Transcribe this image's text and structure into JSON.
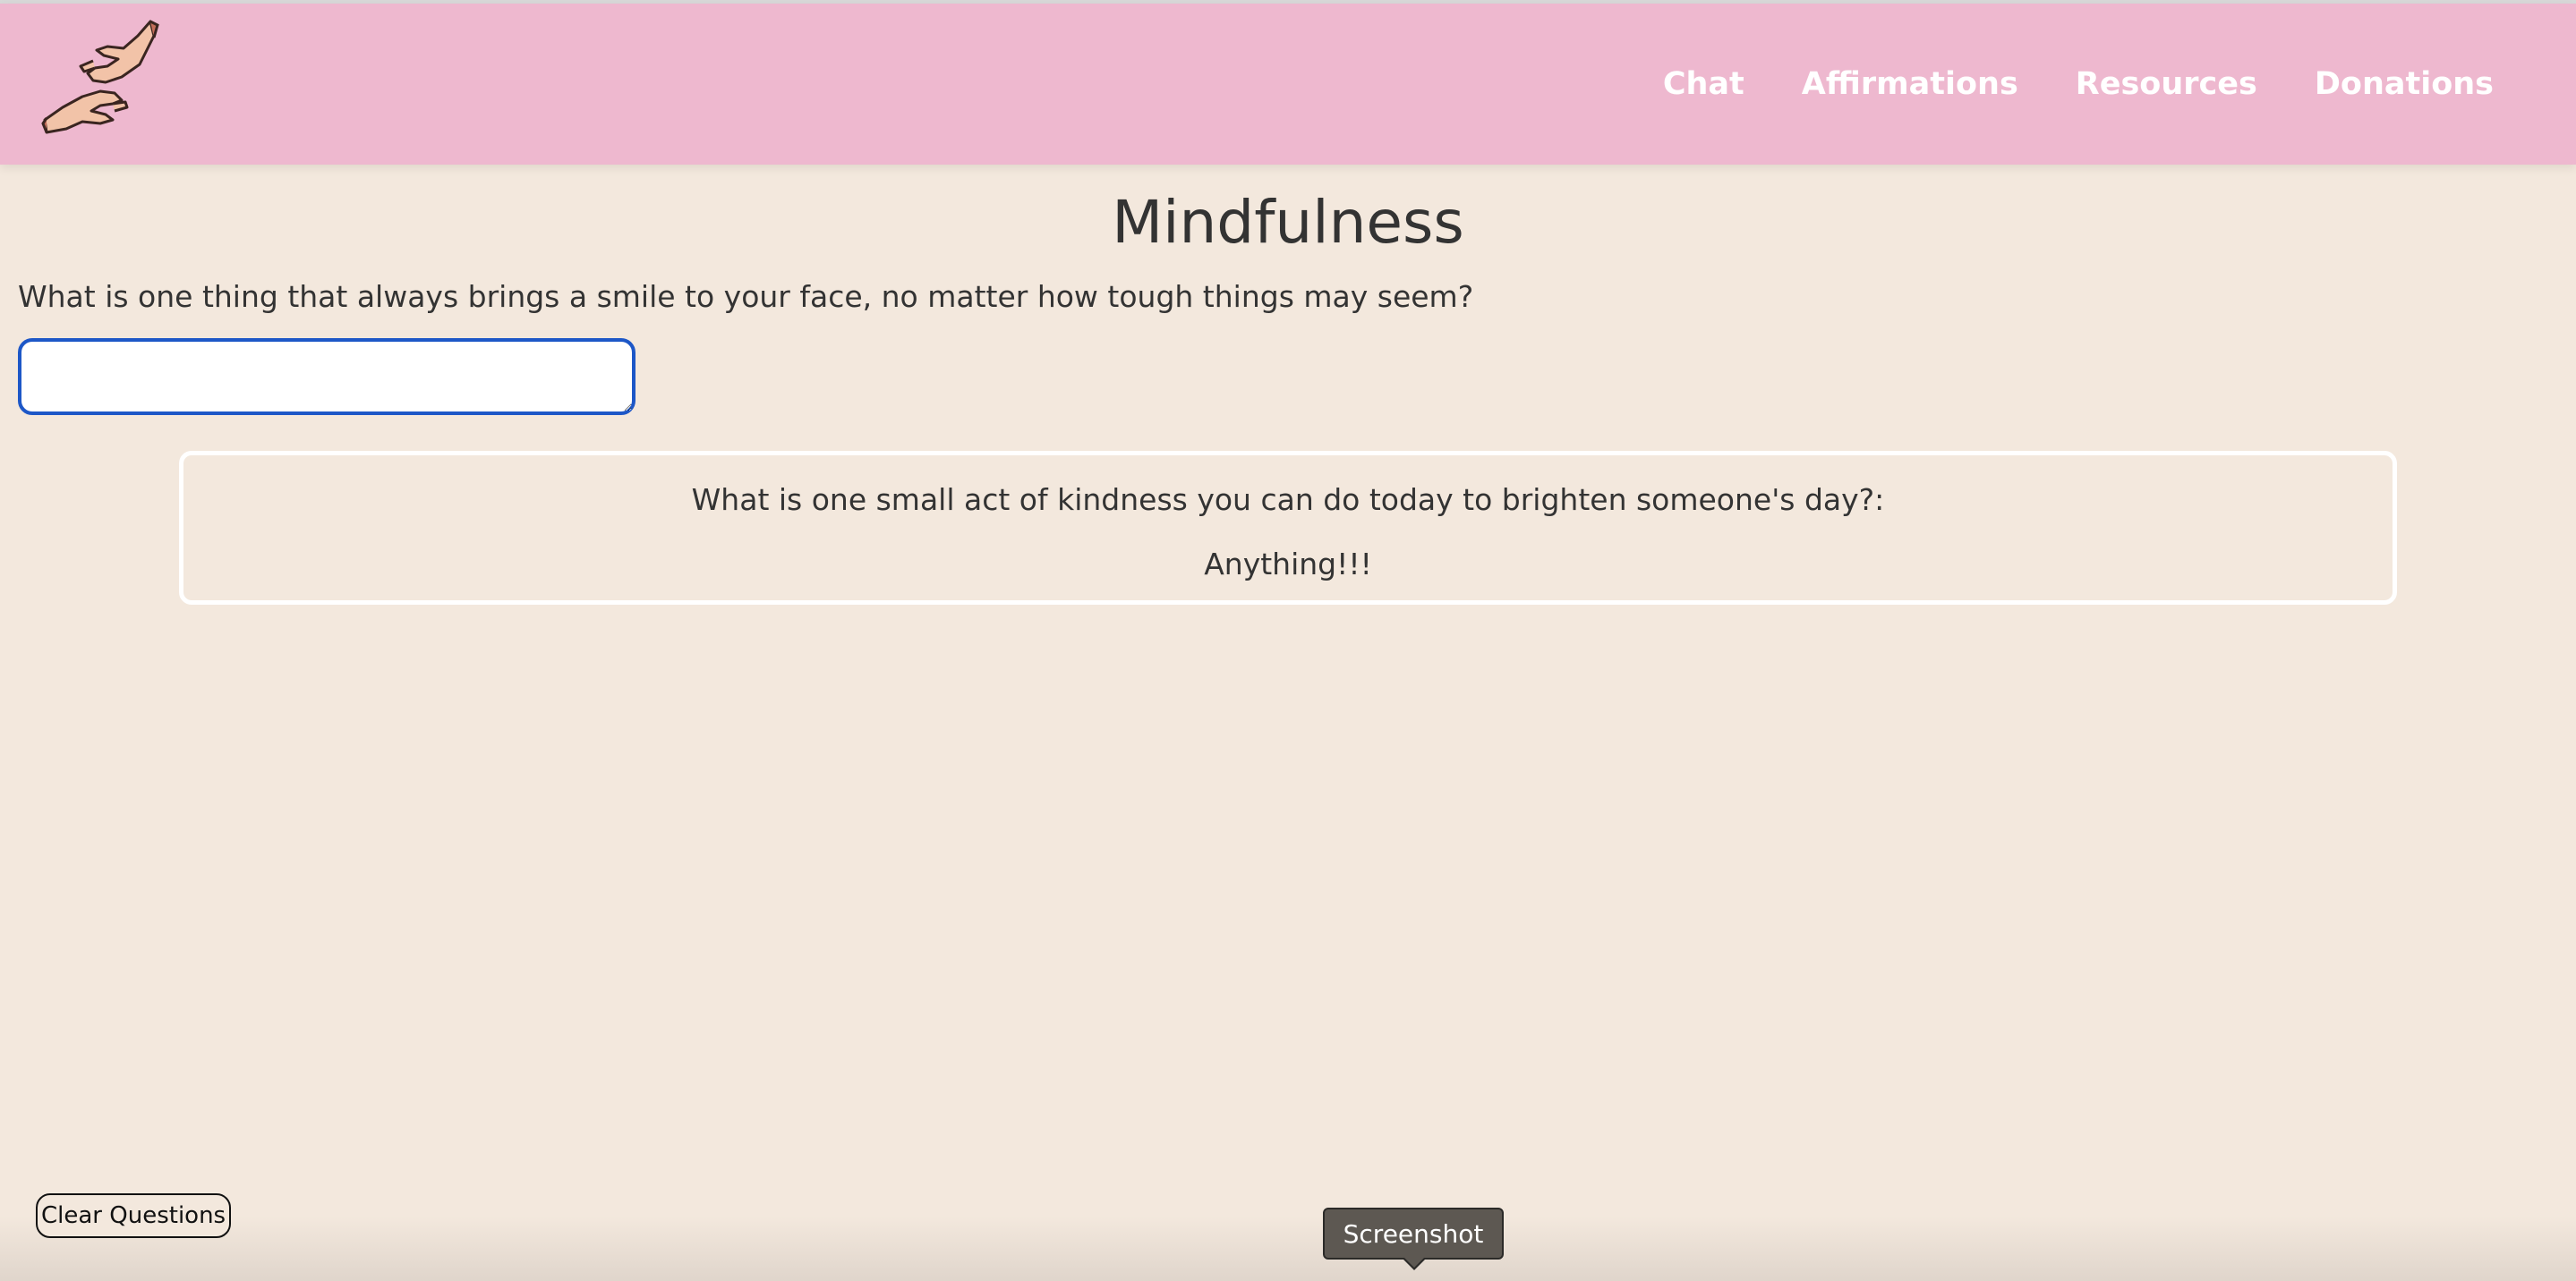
{
  "nav": {
    "logo_icon": "hands-reaching-icon",
    "links": [
      "Chat",
      "Affirmations",
      "Resources",
      "Donations"
    ],
    "background": "#eeb8cf"
  },
  "main": {
    "title": "Mindfulness",
    "question": "What is one thing that always brings a smile to your face, no matter how tough things may seem?",
    "answer_value": "",
    "card": {
      "prompt": "What is one small act of kindness you can do today to brighten someone's day?:",
      "answer": "Anything!!!"
    }
  },
  "footer": {
    "clear_label": "Clear Questions",
    "tooltip": "Screenshot"
  },
  "colors": {
    "page_background": "#f3e8dd",
    "input_focus": "#1d57c7"
  }
}
